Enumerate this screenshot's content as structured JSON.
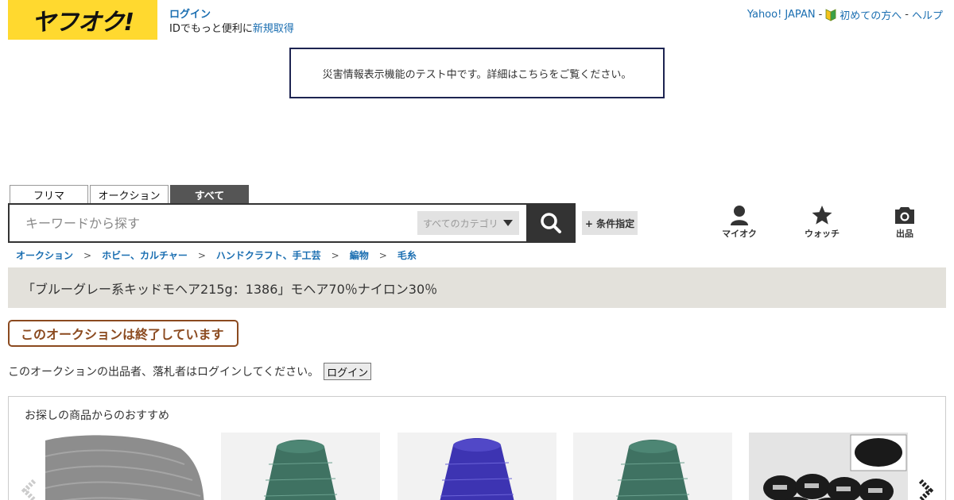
{
  "logo": {
    "text": "ヤフオク!",
    "color": "#ffd92f"
  },
  "header": {
    "login_label": "ログイン",
    "login_sub_text": "IDでもっと便利に",
    "signup_label": "新規取得",
    "links": [
      {
        "label": "Yahoo! JAPAN"
      },
      {
        "label": "初めての方へ",
        "icon": "beginner-mark-icon"
      },
      {
        "label": "ヘルプ"
      }
    ],
    "separator": "-"
  },
  "notice": {
    "text": "災害情報表示機能のテスト中です。詳細はこちらをご覧ください。"
  },
  "search": {
    "tabs": [
      {
        "label": "フリマ",
        "active": false
      },
      {
        "label": "オークション",
        "active": false
      },
      {
        "label": "すべて",
        "active": true
      }
    ],
    "placeholder": "キーワードから探す",
    "category_label": "すべてのカテゴリ",
    "condition_label": "+ 条件指定",
    "search_icon": "search-icon"
  },
  "nav": [
    {
      "label": "マイオク",
      "icon": "person-icon"
    },
    {
      "label": "ウォッチ",
      "icon": "star-icon"
    },
    {
      "label": "出品",
      "icon": "camera-icon"
    }
  ],
  "breadcrumb": {
    "items": [
      "オークション",
      "ホビー、カルチャー",
      "ハンドクラフト、手工芸",
      "編物",
      "毛糸"
    ],
    "separator": ">"
  },
  "product": {
    "title": "「ブルーグレー系キッドモヘア215g：1386」モヘア70％ナイロン30％",
    "ended_label": "このオークションは終了しています",
    "ended_color": "#8b4a1f"
  },
  "login_prompt": {
    "text": "このオークションの出品者、落札者はログインしてください。",
    "button_label": "ログイン"
  },
  "recommend": {
    "title": "お探しの商品からのおすすめ",
    "items": [
      {
        "image": "gray-knit-fabric"
      },
      {
        "image": "teal-mohair-cone"
      },
      {
        "image": "blue-violet-mohair-cone"
      },
      {
        "image": "teal-mohair-cone"
      },
      {
        "image": "black-yarn-balls"
      }
    ]
  },
  "colors": {
    "link": "#1a6eb1",
    "notice_border": "#1d2451",
    "title_bg": "#e3e1db"
  }
}
